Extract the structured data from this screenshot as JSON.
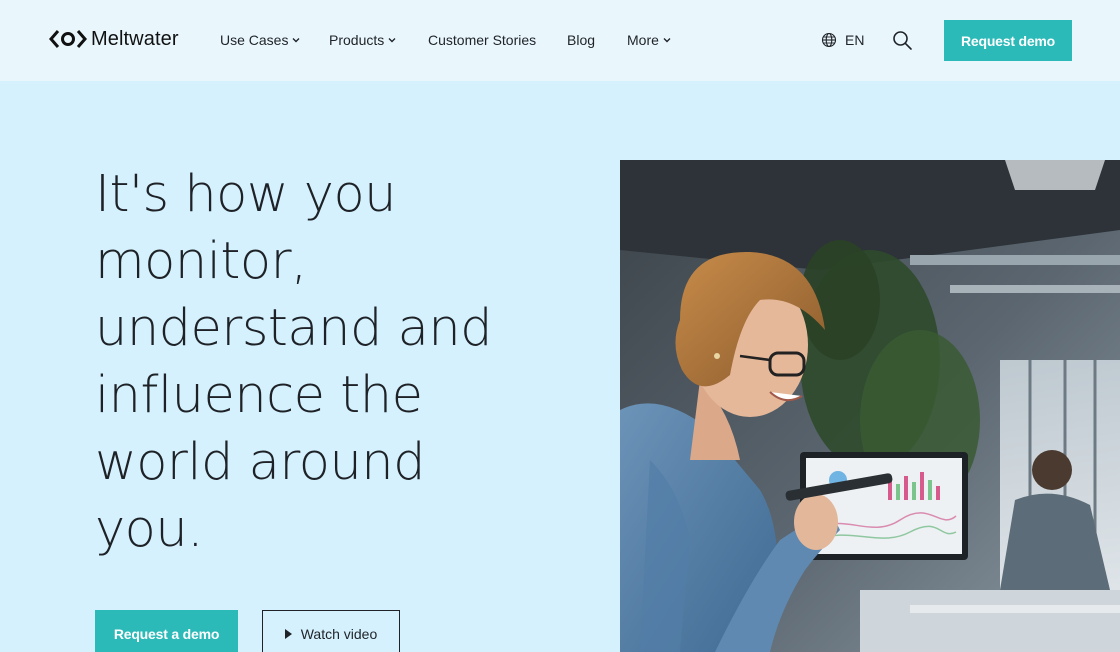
{
  "brand": {
    "name": "Meltwater"
  },
  "nav": {
    "items": [
      {
        "label": "Use Cases",
        "has_dropdown": true
      },
      {
        "label": "Products",
        "has_dropdown": true
      },
      {
        "label": "Customer Stories",
        "has_dropdown": false
      },
      {
        "label": "Blog",
        "has_dropdown": false
      },
      {
        "label": "More",
        "has_dropdown": true
      }
    ],
    "language": "EN",
    "search_icon": "search-icon",
    "cta": "Request demo"
  },
  "hero": {
    "headline": "It's how you monitor, understand and influence the world around you.",
    "primary_cta": "Request a demo",
    "secondary_cta": "Watch video",
    "image_alt": "Smiling woman with glasses speaking into a smartphone in an office"
  },
  "colors": {
    "accent": "#2bbab8",
    "hero_background": "#d4f1fd",
    "header_background": "#e9f7fd",
    "text": "#1f2328"
  }
}
